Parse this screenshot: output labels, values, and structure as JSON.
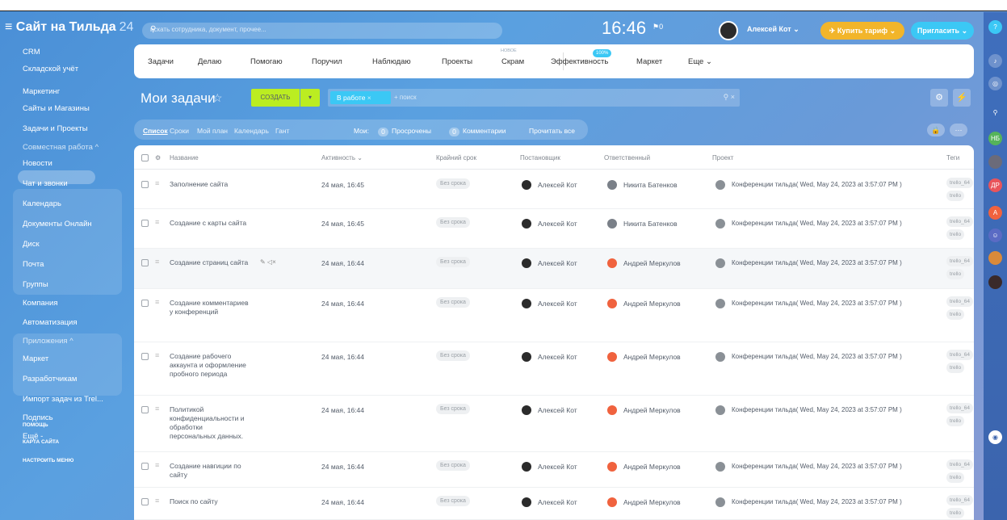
{
  "topbar": {
    "brand": "Сайт на Тильда",
    "brand_num": "24",
    "search_placeholder": "искать сотрудника, документ, прочее...",
    "clock": "16:46",
    "clock_flag": "⚑0",
    "user_name": "Алексей Кот",
    "buy_label": "Купить тариф",
    "invite_label": "Пригласить"
  },
  "sidebar": {
    "items": [
      "CRM",
      "Складской учёт",
      "Маркетинг",
      "Сайты и Магазины",
      "Задачи и Проекты",
      "Совместная работа ^",
      "Новости",
      "Чат и звонки",
      "Календарь",
      "Документы Онлайн",
      "Диск",
      "Почта",
      "Группы",
      "Компания",
      "Автоматизация",
      "Приложения ^",
      "Маркет",
      "Разработчикам",
      "Импорт задач из Trel...",
      "Подпись",
      "Ещё -"
    ],
    "footer": [
      "ПОМОЩЬ",
      "КАРТА САЙТА",
      "НАСТРОИТЬ МЕНЮ"
    ]
  },
  "tabs": {
    "items": [
      "Задачи",
      "Делаю",
      "Помогаю",
      "Поручил",
      "Наблюдаю",
      "Проекты",
      "Скрам",
      "Эффективность",
      "Маркет",
      "Еще ⌄"
    ],
    "new_badge": "НОВОЕ",
    "eff_badge": "100%"
  },
  "toolbar": {
    "title": "Мои задачи",
    "create_label": "СОЗДАТЬ",
    "filter_chip": "В работе",
    "filter_placeholder": "+ поиск"
  },
  "subnav": {
    "views": [
      "Список",
      "Сроки",
      "Мой план",
      "Календарь",
      "Гант"
    ],
    "mine_label": "Мои:",
    "overdue_count": "0",
    "overdue_label": "Просрочены",
    "comments_count": "0",
    "comments_label": "Комментарии",
    "read_all": "Прочитать все"
  },
  "table": {
    "headers": {
      "name": "Название",
      "activity": "Активность ⌄",
      "deadline": "Крайний срок",
      "creator": "Постановщик",
      "responsible": "Ответственный",
      "project": "Проект",
      "tags": "Теги"
    },
    "rows": [
      {
        "name": "Заполнение сайта",
        "activity": "24 мая, 16:45",
        "deadline": "Без срока",
        "creator": "Алексей Кот",
        "responsible": "Никита Батенков",
        "project": "Конференции тильда( Wed, May 24, 2023 at 3:57:07 PM )",
        "tag": "trello_64",
        "tag2": "trello"
      },
      {
        "name": "Создание с карты сайта",
        "activity": "24 мая, 16:45",
        "deadline": "Без срока",
        "creator": "Алексей Кот",
        "responsible": "Никита Батенков",
        "project": "Конференции тильда( Wed, May 24, 2023 at 3:57:07 PM )",
        "tag": "trello_64",
        "tag2": "trello"
      },
      {
        "name": "Создание страниц сайта",
        "activity": "24 мая, 16:44",
        "deadline": "Без срока",
        "creator": "Алексей Кот",
        "responsible": "Андрей Меркулов",
        "project": "Конференции тильда( Wed, May 24, 2023 at 3:57:07 PM )",
        "tag": "trello_64",
        "tag2": "trello"
      },
      {
        "name": "Создание комментариев у конференций",
        "activity": "24 мая, 16:44",
        "deadline": "Без срока",
        "creator": "Алексей Кот",
        "responsible": "Андрей Меркулов",
        "project": "Конференции тильда( Wed, May 24, 2023 at 3:57:07 PM )",
        "tag": "trello_64",
        "tag2": "trello"
      },
      {
        "name": "Создание рабочего аккаунта и оформление пробного периода",
        "activity": "24 мая, 16:44",
        "deadline": "Без срока",
        "creator": "Алексей Кот",
        "responsible": "Андрей Меркулов",
        "project": "Конференции тильда( Wed, May 24, 2023 at 3:57:07 PM )",
        "tag": "trello_64",
        "tag2": "trello"
      },
      {
        "name": "Политикой конфиденциальности и обработки персональных данных.",
        "activity": "24 мая, 16:44",
        "deadline": "Без срока",
        "creator": "Алексей Кот",
        "responsible": "Андрей Меркулов",
        "project": "Конференции тильда( Wed, May 24, 2023 at 3:57:07 PM )",
        "tag": "trello_64",
        "tag2": "trello"
      },
      {
        "name": "Создание навгиции по сайту",
        "activity": "24 мая, 16:44",
        "deadline": "Без срока",
        "creator": "Алексей Кот",
        "responsible": "Андрей Меркулов",
        "project": "Конференции тильда( Wed, May 24, 2023 at 3:57:07 PM )",
        "tag": "trello_64",
        "tag2": "trello"
      },
      {
        "name": "Поиск по сайту",
        "activity": "24 мая, 16:44",
        "deadline": "Без срока",
        "creator": "Алексей Кот",
        "responsible": "Андрей Меркулов",
        "project": "Конференции тильда( Wed, May 24, 2023 at 3:57:07 PM )",
        "tag": "trello_64",
        "tag2": "trello"
      }
    ]
  },
  "rightbar": {
    "nb_label": "НБ",
    "dr_label": "ДР",
    "a_label": "А"
  },
  "colors": {
    "create_btn": "#bbed21",
    "chip": "#3bc8f5",
    "buy": "#f2b52a",
    "avatar_red": "#f0623e"
  }
}
